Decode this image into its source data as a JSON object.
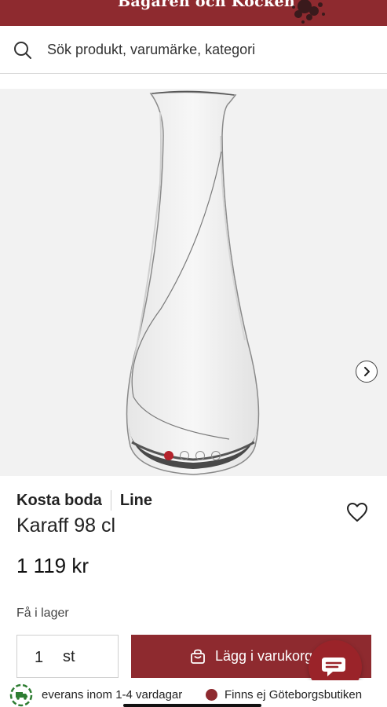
{
  "header": {
    "logo_text": "Bagaren och Kocken",
    "brand_color": "#8e2a2f"
  },
  "search": {
    "placeholder": "Sök produkt, varumärke, kategori",
    "icon": "search-icon"
  },
  "gallery": {
    "image_count": 4,
    "active_index": 0,
    "next_icon": "chevron-right-icon",
    "active_dot_color": "#b4232c"
  },
  "product": {
    "brand": "Kosta boda",
    "series": "Line",
    "title": "Karaff 98 cl",
    "price": "1 119 kr",
    "stock_status": "Få i lager"
  },
  "purchase": {
    "quantity": "1",
    "unit": "st",
    "add_to_cart_label": "Lägg i varukorg"
  },
  "info": {
    "delivery_text": "everans inom 1-4 vardagar",
    "store_text": "Finns ej Göteborgsbutiken",
    "store_status_color": "#8e2a2f"
  }
}
